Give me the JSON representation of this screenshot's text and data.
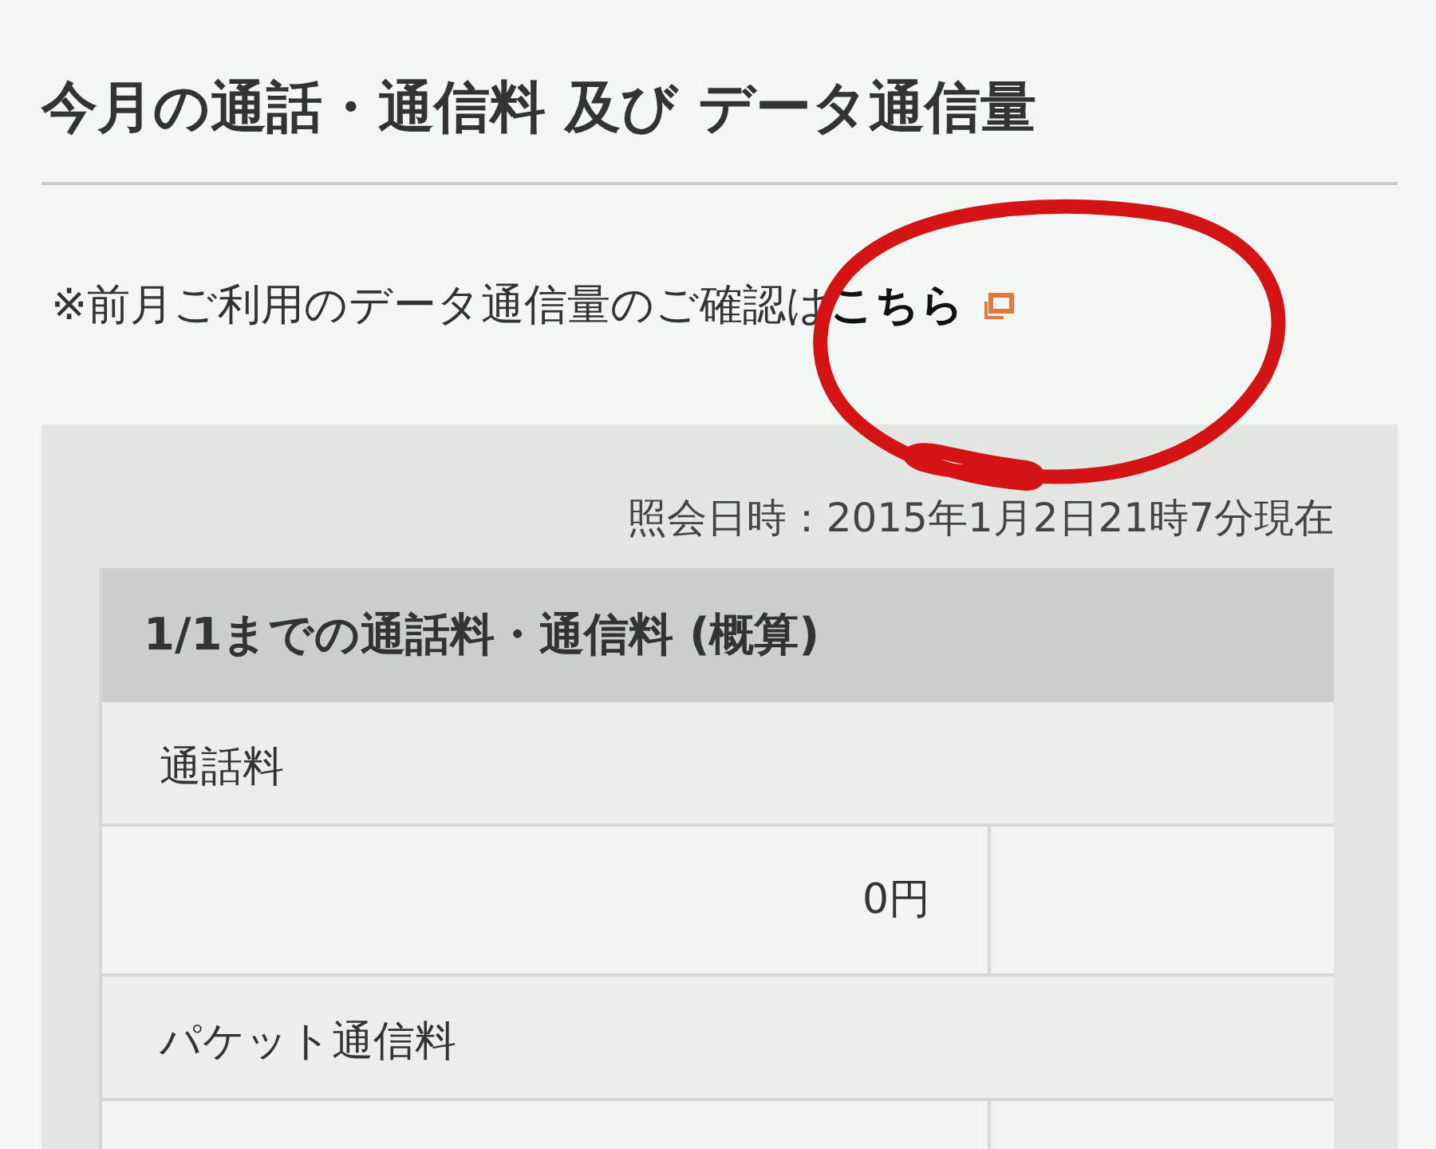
{
  "title": "今月の通話・通信料 及び データ通信量",
  "note": {
    "text": "※前月ご利用のデータ通信量のご確認は",
    "link": "こちら"
  },
  "annotation": {
    "kind": "hand-drawn-circle"
  },
  "panel": {
    "timestamp": "照会日時：2015年1月2日21時7分現在",
    "table": {
      "heading": "1/1までの通話料・通信料 (概算)",
      "rows": [
        {
          "kind": "label",
          "text": "通話料"
        },
        {
          "kind": "amount",
          "value": "0円"
        },
        {
          "kind": "label",
          "text": "パケット通信料"
        },
        {
          "kind": "amount"
        }
      ]
    }
  }
}
